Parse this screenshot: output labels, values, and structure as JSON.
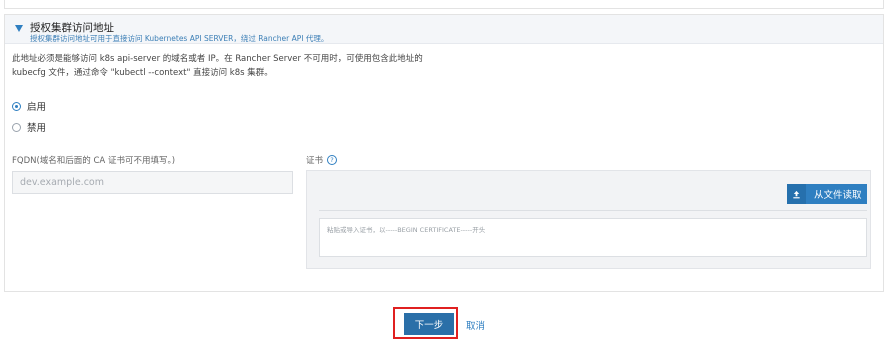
{
  "section": {
    "title": "授权集群访问地址",
    "subtitle": "授权集群访问地址可用于直接访问 Kubernetes API SERVER，绕过 Rancher API 代理。"
  },
  "description": {
    "line1": "此地址必须是能够访问 k8s api-server 的域名或者 IP。在 Rancher Server 不可用时，可使用包含此地址的",
    "line2": "kubecfg 文件，通过命令 \"kubectl --context\" 直接访问 k8s 集群。"
  },
  "radios": {
    "enable_label": "启用",
    "enable_checked": true,
    "disable_label": "禁用",
    "disable_checked": false
  },
  "fqdn": {
    "label": "FQDN(域名和后面的 CA 证书可不用填写。)",
    "placeholder": "dev.example.com",
    "value": ""
  },
  "cert": {
    "label": "证书",
    "read_file_label": "从文件读取",
    "textarea_placeholder": "粘贴或导入证书，以-----BEGIN CERTIFICATE-----开头",
    "textarea_value": ""
  },
  "footer": {
    "next_label": "下一步",
    "cancel_label": "取消"
  },
  "icons": {
    "expand": "caret-down-icon",
    "help": "question-circle-icon",
    "upload": "upload-icon"
  },
  "colors": {
    "accent": "#2f7fc1",
    "primary_button": "#2a6fa8",
    "highlight": "#e02020"
  }
}
